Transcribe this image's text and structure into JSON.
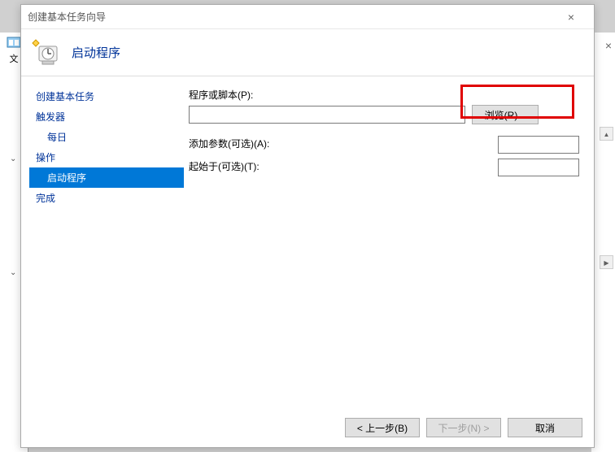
{
  "background": {
    "label": "文"
  },
  "wizard": {
    "title": "创建基本任务向导",
    "header_title": "启动程序",
    "sidebar": {
      "create": "创建基本任务",
      "trigger": "触发器",
      "daily": "每日",
      "action": "操作",
      "start_program": "启动程序",
      "finish": "完成"
    },
    "form": {
      "program_label": "程序或脚本(P):",
      "program_value": "",
      "browse_label": "浏览(R)...",
      "args_label": "添加参数(可选)(A):",
      "args_value": "",
      "startin_label": "起始于(可选)(T):",
      "startin_value": ""
    },
    "footer": {
      "back": "< 上一步(B)",
      "next": "下一步(N) >",
      "cancel": "取消"
    }
  }
}
